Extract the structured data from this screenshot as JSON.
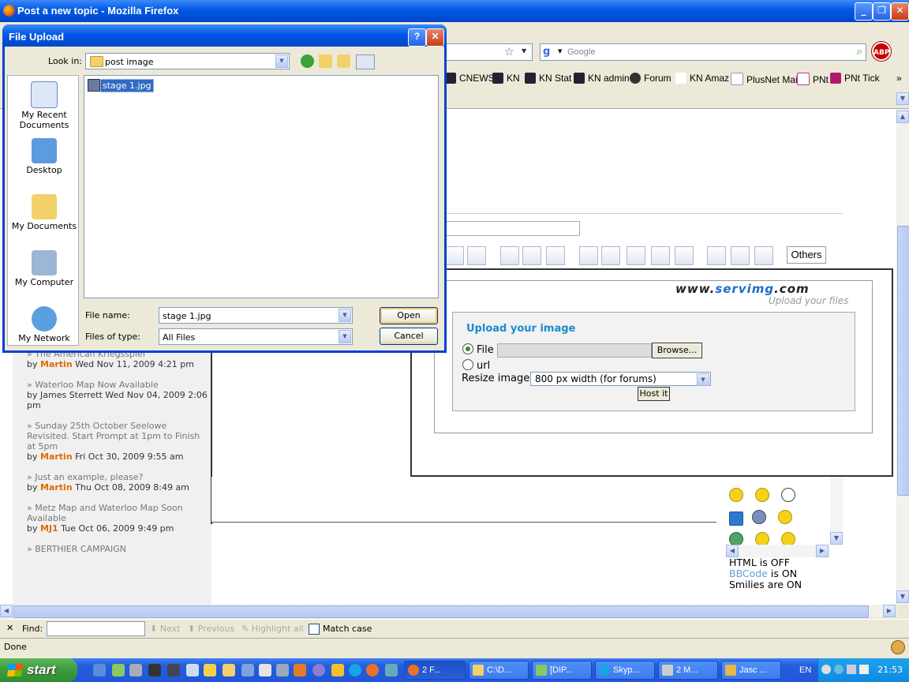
{
  "window": {
    "title": "Post a new topic - Mozilla Firefox",
    "controls": [
      "_",
      "❐",
      "✕"
    ]
  },
  "search": {
    "placeholder": "Google"
  },
  "abp": {
    "label": "ABP"
  },
  "bookmarks": [
    {
      "label": "CNEWS",
      "icon": "kn-icon"
    },
    {
      "label": "KN",
      "icon": "kn-icon"
    },
    {
      "label": "KN Stat",
      "icon": "kn-icon"
    },
    {
      "label": "KN admin",
      "icon": "kn-icon"
    },
    {
      "label": "Forum",
      "icon": "spiral-icon"
    },
    {
      "label": "KN Amaz",
      "icon": "amazon-icon"
    },
    {
      "label": "PlusNet Mail",
      "icon": "page-icon"
    },
    {
      "label": "PNt",
      "icon": "cross-icon"
    },
    {
      "label": "PNt Tick",
      "icon": "cross-icon"
    }
  ],
  "bookmarks_overflow": "»",
  "editor": {
    "others_label": "Others"
  },
  "posts": [
    {
      "title": "» The American Kriegsspiel",
      "by": "by",
      "author": "Martin",
      "date": "Wed Nov 11, 2009 4:21 pm"
    },
    {
      "title": "» Waterloo Map Now Available",
      "by": "by",
      "author": "James Sterrett",
      "date": "Wed Nov 04, 2009 2:06 pm",
      "plain_author": true
    },
    {
      "title": "» Sunday 25th October Seelowe Revisited. Start Prompt at 1pm to Finish at 5pm",
      "by": "by",
      "author": "Martin",
      "date": "Fri Oct 30, 2009 9:55 am"
    },
    {
      "title": "» Just an example, please?",
      "by": "by",
      "author": "Martin",
      "date": "Thu Oct 08, 2009 8:49 am"
    },
    {
      "title": "» Metz Map and Waterloo Map Soon Available",
      "by": "by",
      "author": "MJ1",
      "date": "Tue Oct 06, 2009 9:49 pm"
    },
    {
      "title": "» BERTHIER CAMPAIGN",
      "by": "",
      "author": "",
      "date": ""
    }
  ],
  "servimg": {
    "logo_prefix": "www.",
    "logo_brand": "servimg",
    "logo_suffix": ".com",
    "tagline": "Upload your files",
    "upload_title": "Upload your image",
    "file_label": "File",
    "url_label": "url",
    "browse_label": "Browse...",
    "resize_label": "Resize image",
    "resize_value": "800 px width (for forums)",
    "host_label": "Host it"
  },
  "bbinfo": {
    "html": "HTML is OFF",
    "bbcode_link": "BBCode",
    "bbcode_rest": " is ON",
    "smilies": "Smilies are ON"
  },
  "findbar": {
    "close": "✕",
    "label": "Find:",
    "next": "Next",
    "previous": "Previous",
    "highlight": "Highlight all",
    "match_case": "Match case"
  },
  "status": {
    "text": "Done"
  },
  "taskbar": {
    "start": "start",
    "tasks": [
      {
        "label": "2 F...",
        "icon": "firefox-icon",
        "active": true
      },
      {
        "label": "C:\\D...",
        "icon": "folder-icon"
      },
      {
        "label": "[DIP...",
        "icon": "app-icon"
      },
      {
        "label": "Skyp...",
        "icon": "skype-icon"
      },
      {
        "label": "2 M...",
        "icon": "app-icon"
      },
      {
        "label": "Jasc ...",
        "icon": "paint-icon"
      }
    ],
    "lang": "EN",
    "clock": "21:53"
  },
  "dialog": {
    "title": "File Upload",
    "help": "?",
    "close": "✕",
    "look_in_label": "Look in:",
    "look_in_value": "post image",
    "places": [
      "My Recent Documents",
      "Desktop",
      "My Documents",
      "My Computer",
      "My Network"
    ],
    "files": [
      "stage 1.jpg"
    ],
    "file_name_label": "File name:",
    "file_name_value": "stage 1.jpg",
    "file_type_label": "Files of type:",
    "file_type_value": "All Files",
    "open_label": "Open",
    "cancel_label": "Cancel"
  }
}
